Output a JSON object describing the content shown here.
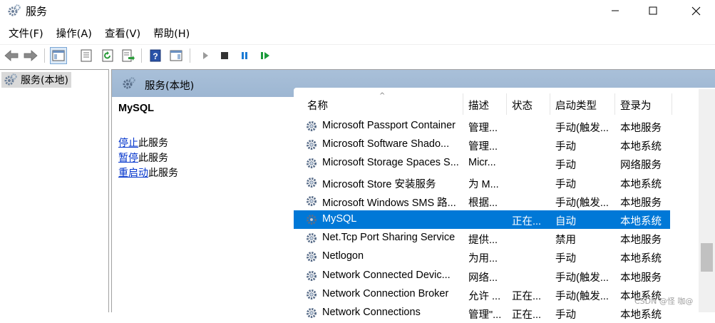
{
  "window": {
    "title": "服务"
  },
  "menu": [
    "文件(F)",
    "操作(A)",
    "查看(V)",
    "帮助(H)"
  ],
  "tree": {
    "item": "服务(本地)"
  },
  "pane": {
    "title": "服务(本地)"
  },
  "detail": {
    "name": "MySQL",
    "actions": [
      {
        "link": "停止",
        "rest": "此服务"
      },
      {
        "link": "暂停",
        "rest": "此服务"
      },
      {
        "link": "重启动",
        "rest": "此服务"
      }
    ]
  },
  "columns": {
    "name": "名称",
    "desc": "描述",
    "state": "状态",
    "start": "启动类型",
    "logon": "登录为"
  },
  "rows": [
    {
      "name": "Microsoft Passport Container",
      "desc": "管理...",
      "state": "",
      "start": "手动(触发...",
      "logon": "本地服务"
    },
    {
      "name": "Microsoft Software Shado...",
      "desc": "管理...",
      "state": "",
      "start": "手动",
      "logon": "本地系统"
    },
    {
      "name": "Microsoft Storage Spaces S...",
      "desc": "Micr...",
      "state": "",
      "start": "手动",
      "logon": "网络服务"
    },
    {
      "name": "Microsoft Store 安装服务",
      "desc": "为 M...",
      "state": "",
      "start": "手动",
      "logon": "本地系统"
    },
    {
      "name": "Microsoft Windows SMS 路...",
      "desc": "根据...",
      "state": "",
      "start": "手动(触发...",
      "logon": "本地服务"
    },
    {
      "name": "MySQL",
      "desc": "",
      "state": "正在...",
      "start": "自动",
      "logon": "本地系统",
      "selected": true
    },
    {
      "name": "Net.Tcp Port Sharing Service",
      "desc": "提供...",
      "state": "",
      "start": "禁用",
      "logon": "本地服务"
    },
    {
      "name": "Netlogon",
      "desc": "为用...",
      "state": "",
      "start": "手动",
      "logon": "本地系统"
    },
    {
      "name": "Network Connected Devic...",
      "desc": "网络...",
      "state": "",
      "start": "手动(触发...",
      "logon": "本地服务"
    },
    {
      "name": "Network Connection Broker",
      "desc": "允许 ...",
      "state": "正在...",
      "start": "手动(触发...",
      "logon": "本地系统"
    },
    {
      "name": "Network Connections",
      "desc": "管理\"...",
      "state": "正在...",
      "start": "手动",
      "logon": "本地系统"
    }
  ],
  "watermark": "CSDN @怪 咖@",
  "colors": {
    "selection": "#0078d7",
    "header": "#a9c0d9",
    "link": "#0033cc"
  }
}
